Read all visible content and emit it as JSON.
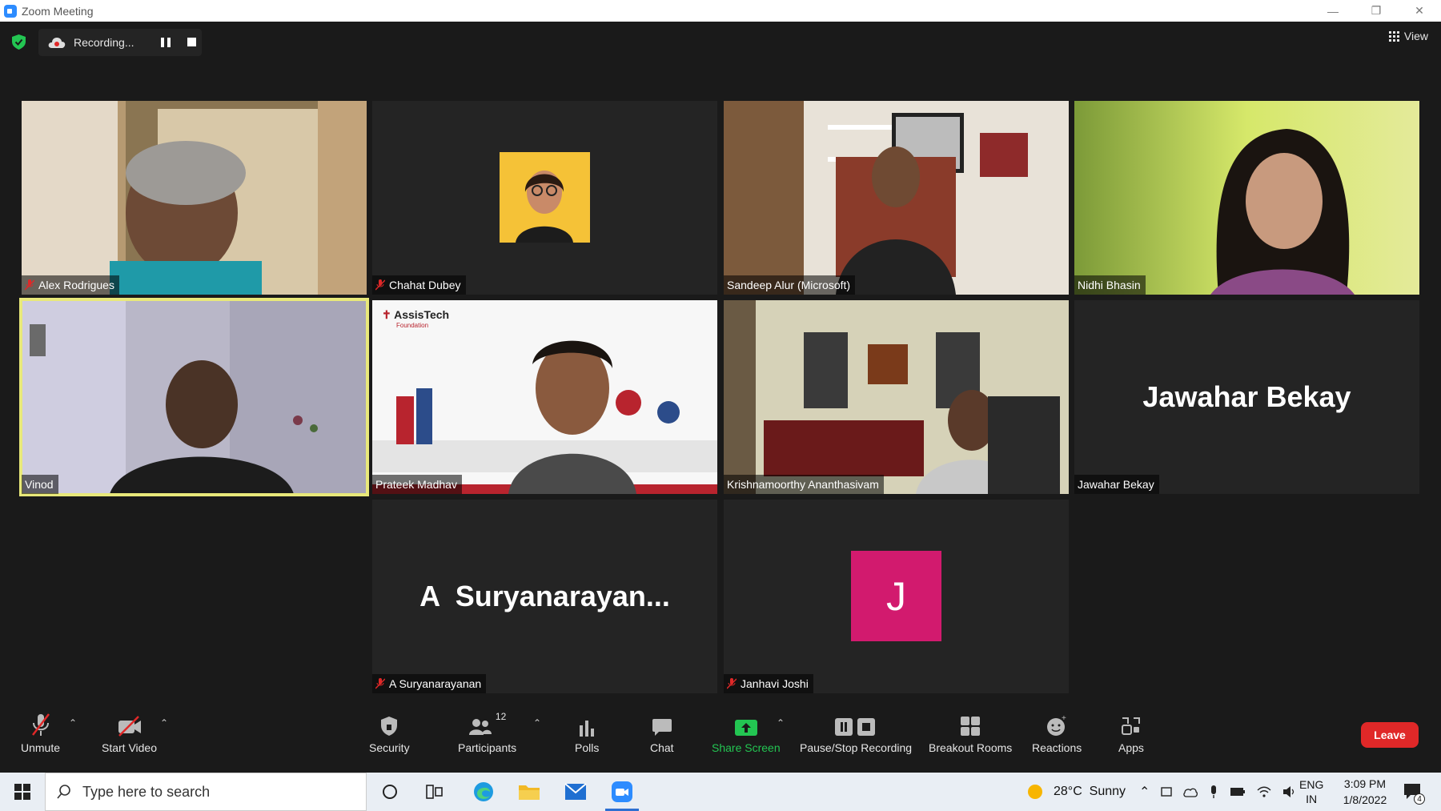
{
  "window": {
    "title": "Zoom Meeting"
  },
  "topbar": {
    "recording_label": "Recording...",
    "view_label": "View"
  },
  "participants": [
    {
      "name": "Alex Rodrigues",
      "muted": true
    },
    {
      "name": "Chahat Dubey",
      "muted": true
    },
    {
      "name": "Sandeep Alur (Microsoft)",
      "muted": false
    },
    {
      "name": "Nidhi Bhasin",
      "muted": false
    },
    {
      "name": "Vinod",
      "muted": false,
      "active_speaker": true
    },
    {
      "name": "Prateek Madhav",
      "muted": false,
      "background_logo": "AssisTech",
      "background_sub": "Foundation"
    },
    {
      "name": "Krishnamoorthy Ananthasivam",
      "muted": false
    },
    {
      "name": "Jawahar Bekay",
      "muted": false,
      "big_name": "Jawahar Bekay"
    },
    {
      "name": "A Suryanarayanan",
      "muted": true,
      "big_name": "A  Suryanarayan..."
    },
    {
      "name": "Janhavi Joshi",
      "muted": true,
      "avatar_letter": "J"
    }
  ],
  "controls": {
    "unmute": "Unmute",
    "start_video": "Start Video",
    "security": "Security",
    "participants": "Participants",
    "participants_count": "12",
    "polls": "Polls",
    "chat": "Chat",
    "share_screen": "Share Screen",
    "pause_stop_recording": "Pause/Stop Recording",
    "breakout_rooms": "Breakout Rooms",
    "reactions": "Reactions",
    "apps": "Apps",
    "leave": "Leave"
  },
  "colors": {
    "active_speaker_border": "#e8e87a",
    "leave_red": "#e02828",
    "share_green": "#23c552",
    "avatar_pink": "#d21a6e"
  },
  "taskbar": {
    "search_placeholder": "Type here to search",
    "weather": "28°C  Sunny",
    "lang_top": "ENG",
    "lang_bottom": "IN",
    "time": "3:09 PM",
    "date": "1/8/2022",
    "notification_count": "4"
  }
}
